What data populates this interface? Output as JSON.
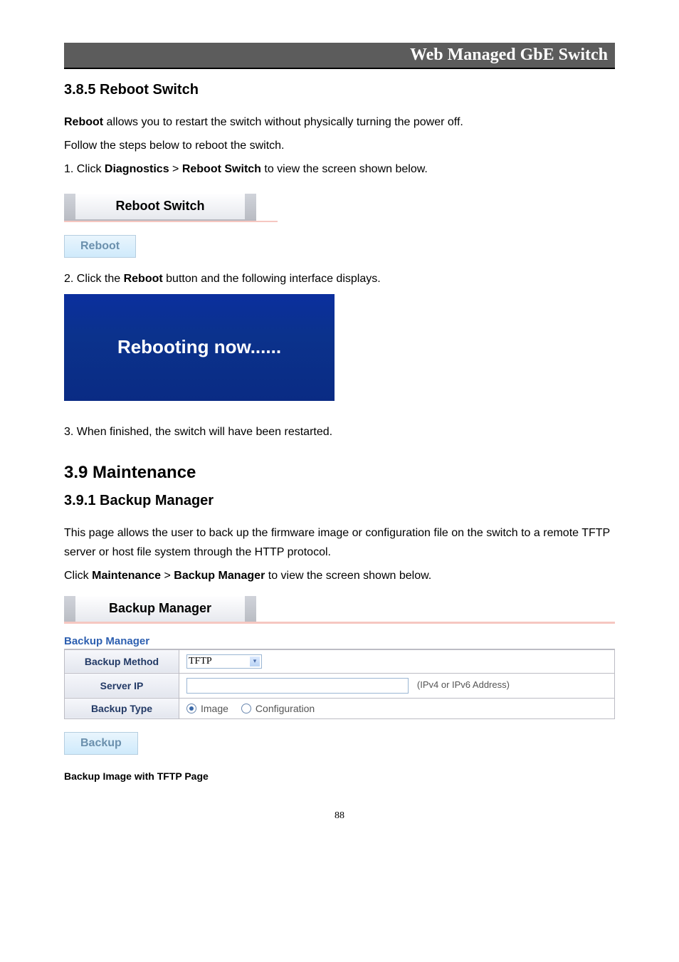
{
  "header": {
    "title": "Web Managed GbE Switch"
  },
  "sections": {
    "reboot": {
      "heading": "3.8.5 Reboot Switch",
      "intro_bold": "Reboot",
      "intro_rest": " allows you to restart the switch without physically turning the power off.",
      "intro_line2": "Follow the steps below to reboot the switch.",
      "step1_prefix": "1. Click ",
      "step1_bold1": "Diagnostics",
      "step1_mid": " > ",
      "step1_bold2": "Reboot Switch",
      "step1_suffix": " to view the screen shown below.",
      "panel_title": "Reboot Switch",
      "reboot_button": "Reboot",
      "step2_prefix": "2. Click the ",
      "step2_bold": "Reboot",
      "step2_suffix": " button and the following interface displays.",
      "rebooting_text": "Rebooting now......",
      "step3": "3. When finished, the switch will have been restarted."
    },
    "maintenance": {
      "heading": "3.9 Maintenance",
      "subheading": "3.9.1 Backup Manager",
      "intro": "This page allows the user to back up the firmware image or configuration file on the switch to a remote TFTP server or host file system through the HTTP protocol.",
      "nav_prefix": "Click ",
      "nav_bold1": "Maintenance",
      "nav_mid": " > ",
      "nav_bold2": "Backup Manager",
      "nav_suffix": " to view the screen shown below.",
      "panel_title": "Backup Manager",
      "section_label": "Backup Manager",
      "form": {
        "method_label": "Backup Method",
        "method_value": "TFTP",
        "server_label": "Server IP",
        "server_value": "",
        "server_hint": "(IPv4 or IPv6 Address)",
        "type_label": "Backup Type",
        "type_image": "Image",
        "type_config": "Configuration"
      },
      "backup_button": "Backup",
      "caption": "Backup Image with TFTP Page"
    }
  },
  "page_number": "88"
}
